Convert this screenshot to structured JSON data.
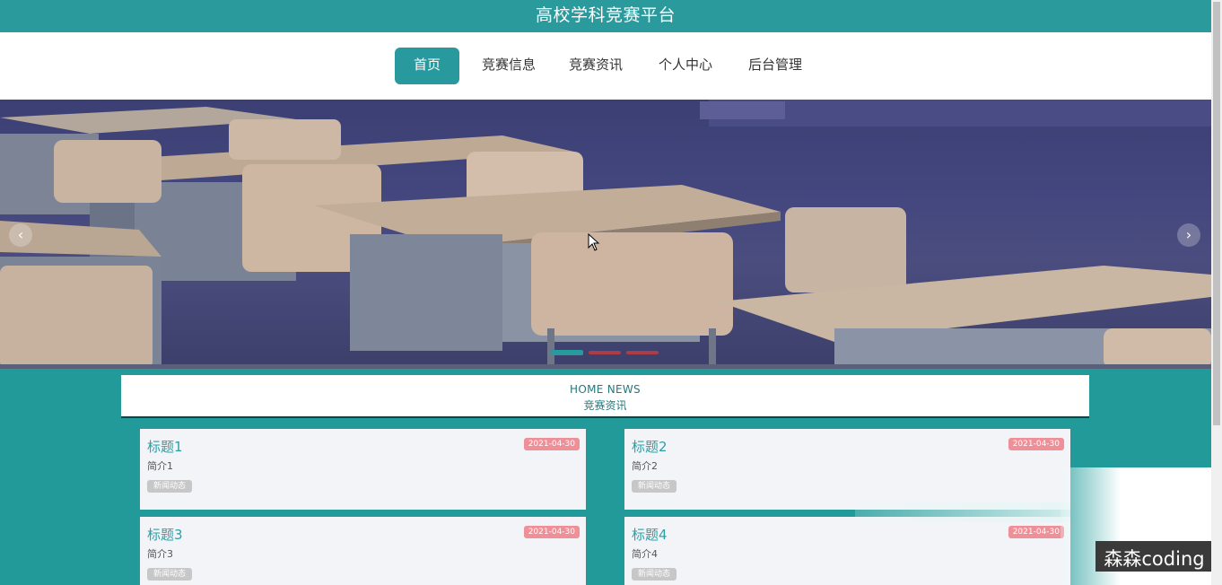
{
  "site_title": "高校学科竞赛平台",
  "nav": {
    "items": [
      {
        "label": "首页",
        "active": true
      },
      {
        "label": "竞赛信息",
        "active": false
      },
      {
        "label": "竞赛资讯",
        "active": false
      },
      {
        "label": "个人中心",
        "active": false
      },
      {
        "label": "后台管理",
        "active": false
      }
    ]
  },
  "carousel": {
    "prev_icon": "‹",
    "next_icon": "›",
    "indicator_count": 3,
    "active_index": 0
  },
  "news_section": {
    "heading_en": "HOME NEWS",
    "heading_cn": "竞赛资讯",
    "cards": [
      {
        "title": "标题1",
        "summary": "简介1",
        "tag": "新闻动态",
        "date": "2021-04-30"
      },
      {
        "title": "标题2",
        "summary": "简介2",
        "tag": "新闻动态",
        "date": "2021-04-30"
      },
      {
        "title": "标题3",
        "summary": "简介3",
        "tag": "新闻动态",
        "date": "2021-04-30"
      },
      {
        "title": "标题4",
        "summary": "简介4",
        "tag": "新闻动态",
        "date": "2021-04-30"
      }
    ]
  },
  "watermark": "森森coding",
  "colors": {
    "primary": "#28999c",
    "date_badge": "#ef8f98",
    "card_bg": "#f2f4f8"
  }
}
